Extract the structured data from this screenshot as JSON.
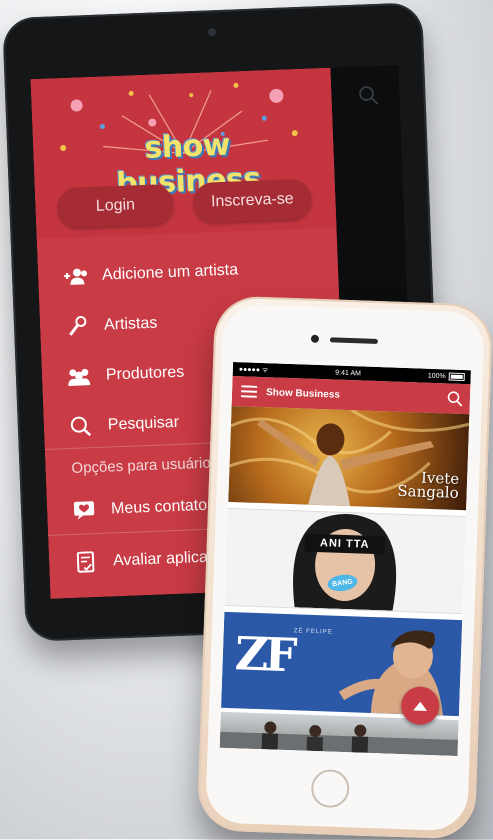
{
  "tablet": {
    "logo_text": "show business",
    "buttons": {
      "login": "Login",
      "signup": "Inscreva-se"
    },
    "menu": [
      {
        "label": "Adicione um artista",
        "icon": "add-user-icon"
      },
      {
        "label": "Artistas",
        "icon": "microphone-icon"
      },
      {
        "label": "Produtores",
        "icon": "group-icon"
      },
      {
        "label": "Pesquisar",
        "icon": "search-icon"
      }
    ],
    "section_label": "Opções para usuário",
    "user_menu": [
      {
        "label": "Meus contatos",
        "icon": "heart-chat-icon"
      },
      {
        "label": "Avaliar aplicativo",
        "icon": "rate-app-icon"
      }
    ],
    "accent_color": "#c93b45"
  },
  "phone": {
    "status": {
      "carrier": "●●●●● ᯤ",
      "time": "9:41 AM",
      "battery": "100%"
    },
    "app_title": "Show Business",
    "cards": [
      {
        "caption_line1": "Ivete",
        "caption_line2": "Sangalo"
      },
      {
        "logo": "ANI  TTA",
        "badge": "BANG"
      },
      {
        "logo": "ZF",
        "small": "ZÉ FELIPE"
      },
      {
        "logo": ""
      }
    ]
  }
}
